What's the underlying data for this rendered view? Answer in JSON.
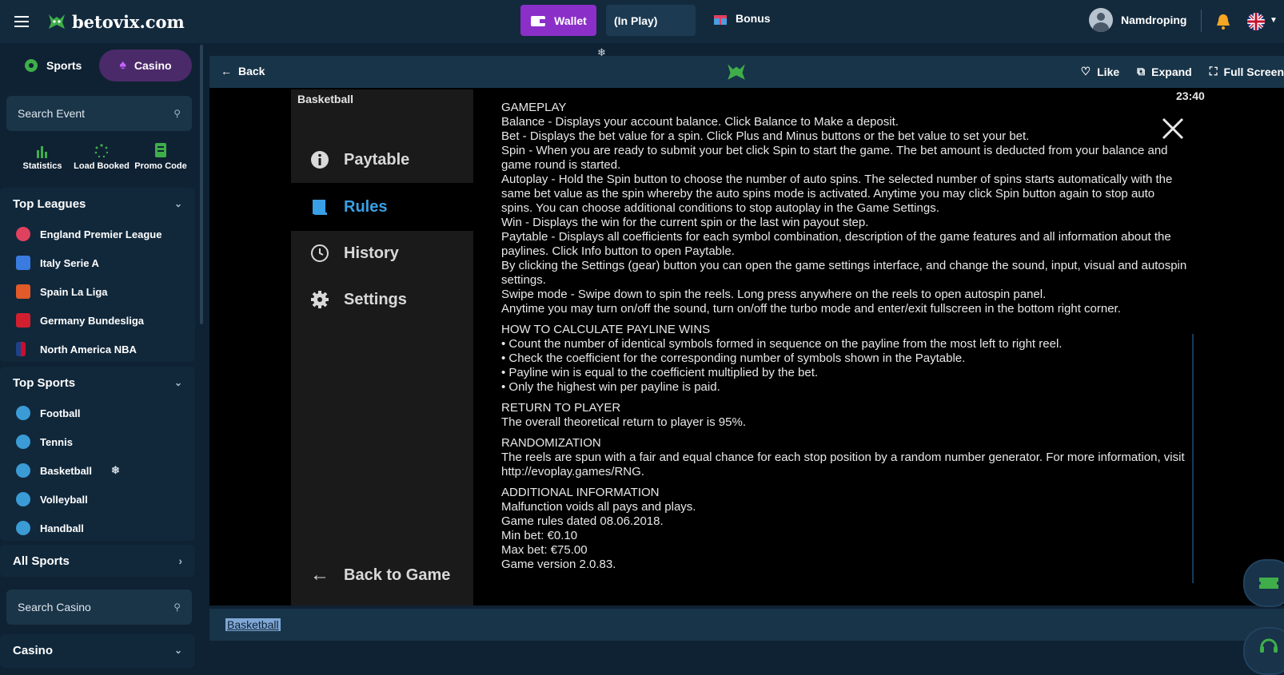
{
  "header": {
    "logo_text": "betovix.com",
    "wallet_label": "Wallet",
    "inplay_label": "(In Play)",
    "bonus_label": "Bonus",
    "username": "Namdroping",
    "accent_color": "#8b2fc9"
  },
  "sidebar": {
    "tab_sports": "Sports",
    "tab_casino": "Casino",
    "search_event_placeholder": "Search Event",
    "quick": [
      "Statistics",
      "Load Booked",
      "Promo Code"
    ],
    "top_leagues": {
      "title": "Top Leagues",
      "items": [
        "England Premier League",
        "Italy Serie A",
        "Spain La Liga",
        "Germany Bundesliga",
        "North America NBA"
      ]
    },
    "top_sports": {
      "title": "Top Sports",
      "items": [
        "Football",
        "Tennis",
        "Basketball",
        "Volleyball",
        "Handball"
      ]
    },
    "all_sports": "All Sports",
    "search_casino_placeholder": "Search Casino",
    "casino_section": "Casino"
  },
  "game_header": {
    "back": "Back",
    "like": "Like",
    "expand": "Expand",
    "fullscreen": "Full Screen"
  },
  "game": {
    "menu_title": "Basketball",
    "menu": [
      "Paytable",
      "Rules",
      "History",
      "Settings"
    ],
    "back_to_game": "Back to Game",
    "clock": "23:40",
    "rules_lines": [
      "GAMEPLAY",
      "Balance - Displays your account balance. Click Balance to Make a deposit.",
      "Bet - Displays the bet value for a spin. Click Plus and Minus buttons or the bet value to set your bet.",
      "Spin - When you are ready to submit your bet click Spin to start the game. The bet amount is deducted from your balance and game round is started.",
      "Autoplay - Hold the Spin button to choose the number of auto spins. The selected number of spins starts automatically with the same bet value as the spin whereby the auto spins mode is activated. Anytime you may click Spin button again to stop auto spins. You can choose additional conditions to stop autoplay in the Game Settings.",
      "Win - Displays the win for the current spin or the last win payout step.",
      "Paytable - Displays all coefficients for each symbol combination, description of the game features and all information about the paylines. Click Info button to open Paytable.",
      "By clicking the Settings (gear) button you can open the game settings interface, and change the sound, input, visual and autospin settings.",
      "Swipe mode - Swipe down to spin the reels. Long press anywhere on the reels to open autospin panel.",
      "Anytime you may turn on/off the sound, turn on/off the turbo mode and enter/exit fullscreen in the bottom right corner."
    ],
    "payline_title": "HOW TO CALCULATE PAYLINE WINS",
    "payline_lines": [
      "• Count the number of identical symbols formed in sequence on the payline from the most left to right reel.",
      "• Check the coefficient for the corresponding number of symbols shown in the Paytable.",
      "• Payline win is equal to the coefficient multiplied by the bet.",
      "• Only the highest win per payline is paid."
    ],
    "rtp_title": "RETURN TO PLAYER",
    "rtp_text": "The overall theoretical return to player is 95%.",
    "random_title": "RANDOMIZATION",
    "random_text": "The reels are spun with a fair and equal chance for each stop position by a random number generator. For more information, visit http://evoplay.games/RNG.",
    "additional_title": "ADDITIONAL INFORMATION",
    "additional_lines": [
      "Malfunction voids all pays and plays.",
      "Game rules dated 08.06.2018.",
      "Min bet: €0.10",
      "Max bet: €75.00",
      "Game version 2.0.83."
    ]
  },
  "bottom": {
    "label": "Basketball"
  }
}
